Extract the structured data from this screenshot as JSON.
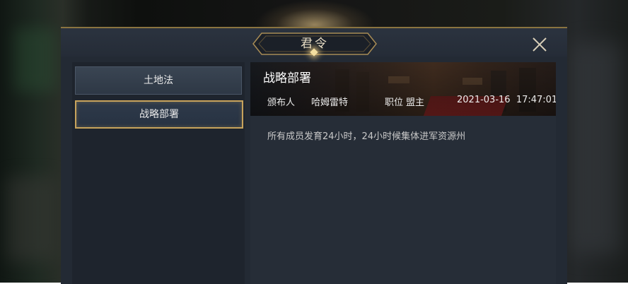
{
  "dialog": {
    "title": "君令"
  },
  "tabs": [
    {
      "label": "土地法",
      "active": false
    },
    {
      "label": "战略部署",
      "active": true
    }
  ],
  "detail": {
    "title": "战略部署",
    "publisher_label": "颁布人",
    "publisher_name": "哈姆雷特",
    "position_label": "职位",
    "position_value": "盟主",
    "timestamp": "2021-03-16  17:47:01",
    "content": "所有成员发育24小时，24小时候集体进军资源州"
  },
  "icons": {
    "close": "close-icon",
    "ornament": "gem-diamond-icon"
  },
  "colors": {
    "gold_accent": "#c7a35c",
    "panel_bg": "#232a34",
    "title_text": "#e7dcc4"
  }
}
